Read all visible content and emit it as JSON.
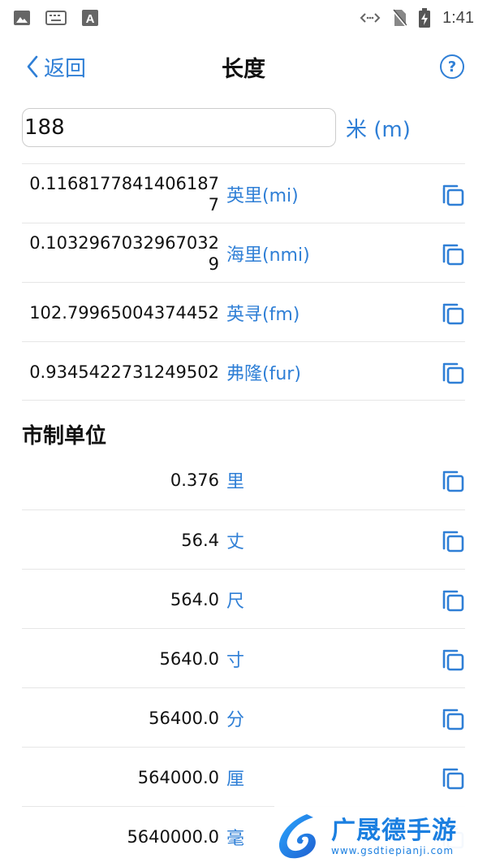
{
  "status": {
    "time": "1:41"
  },
  "nav": {
    "back_label": "返回",
    "title": "长度",
    "help_symbol": "?"
  },
  "input": {
    "value": "188",
    "unit": "米 (m)"
  },
  "imperial_rows": [
    {
      "value": "0.11681778414061877",
      "unit": "英里(mi)"
    },
    {
      "value": "0.10329670329670329",
      "unit": "海里(nmi)"
    },
    {
      "value": "102.79965004374452",
      "unit": "英寻(fm)"
    },
    {
      "value": "0.9345422731249502",
      "unit": "弗隆(fur)"
    }
  ],
  "chinese_section": {
    "title": "市制单位",
    "rows": [
      {
        "value": "0.376",
        "unit": "里"
      },
      {
        "value": "56.4",
        "unit": "丈"
      },
      {
        "value": "564.0",
        "unit": "尺"
      },
      {
        "value": "5640.0",
        "unit": "寸"
      },
      {
        "value": "56400.0",
        "unit": "分"
      },
      {
        "value": "564000.0",
        "unit": "厘"
      },
      {
        "value": "5640000.0",
        "unit": "毫"
      }
    ]
  },
  "watermark": {
    "title": "广晟德手游",
    "url": "www.gsdtiepianji.com"
  },
  "colors": {
    "accent": "#2f7fd6",
    "divider": "#e6e6e6"
  }
}
